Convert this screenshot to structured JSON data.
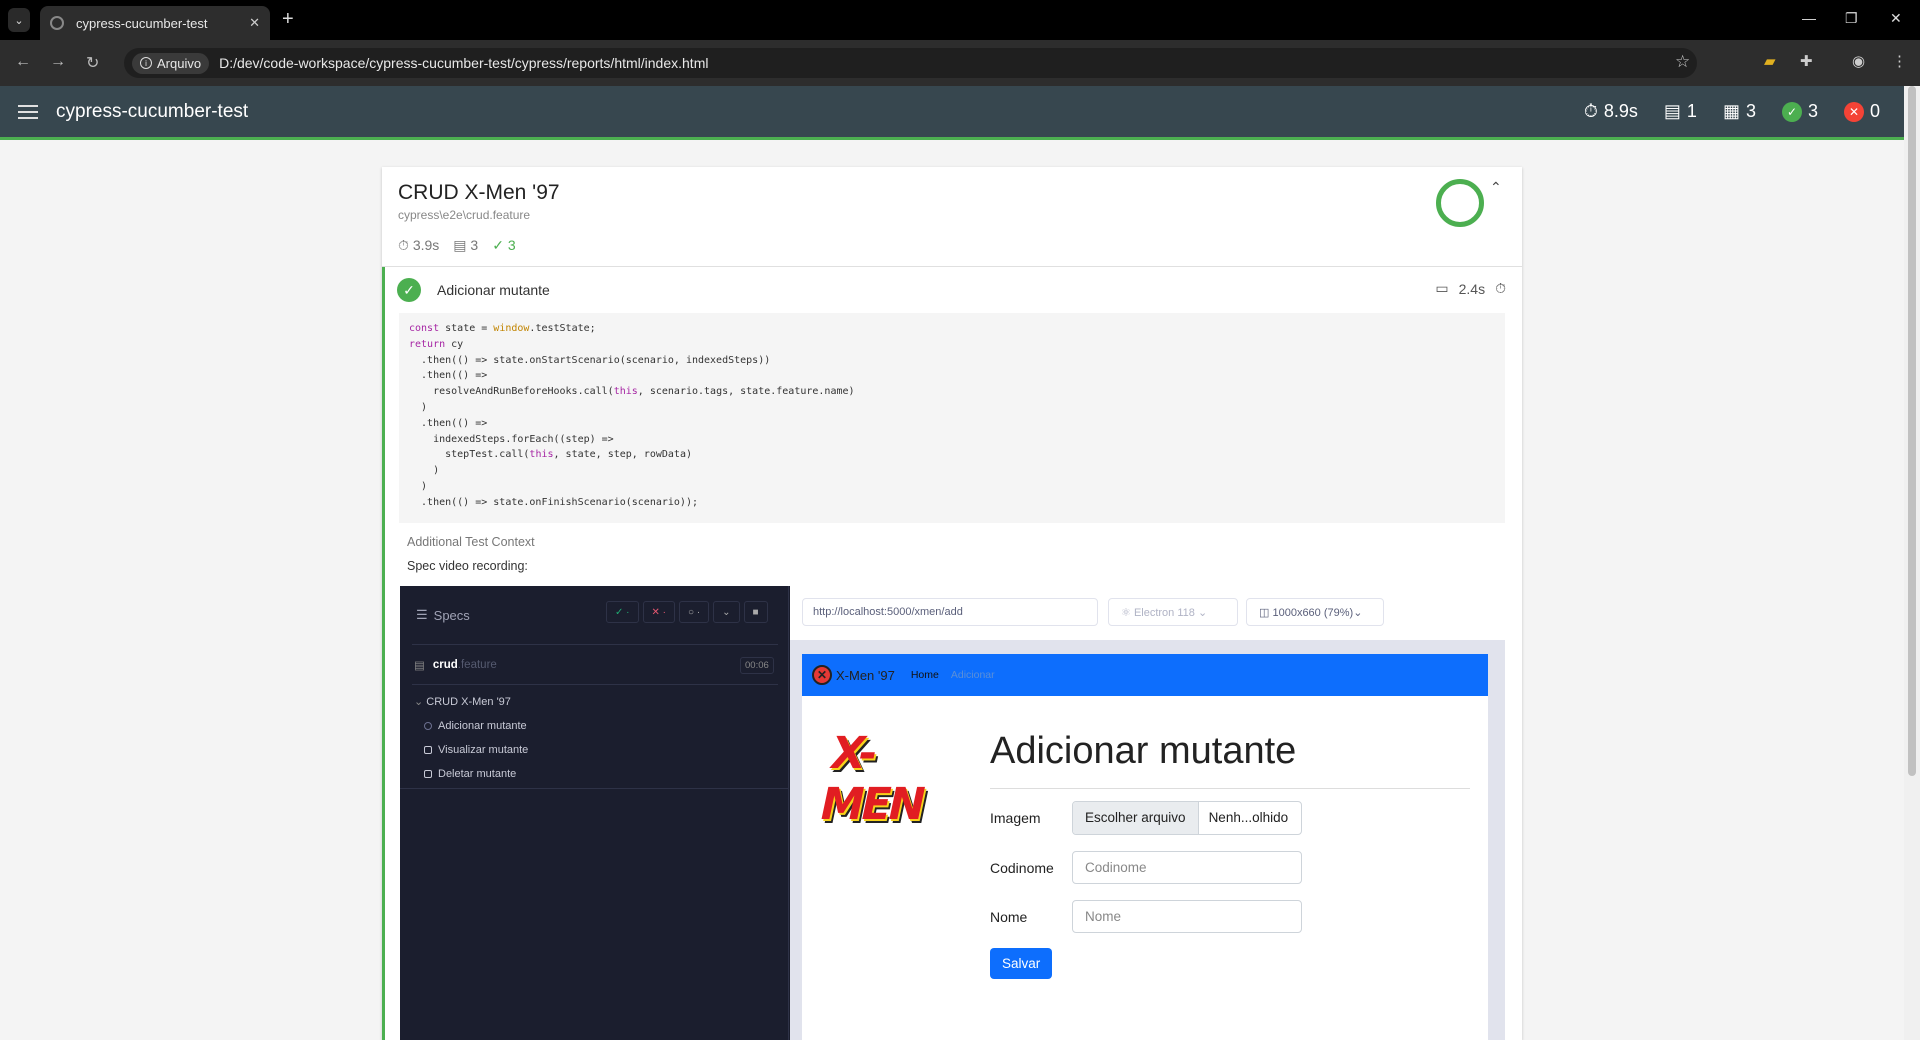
{
  "browser": {
    "tab_title": "cypress-cucumber-test",
    "chip_label": "Arquivo",
    "url": "D:/dev/code-workspace/cypress-cucumber-test/cypress/reports/html/index.html"
  },
  "header": {
    "title": "cypress-cucumber-test",
    "stats": {
      "duration": "8.9s",
      "suites": "1",
      "tests": "3",
      "passed": "3",
      "failed": "0"
    }
  },
  "suite": {
    "title": "CRUD X-Men '97",
    "file": "cypress\\e2e\\crud.feature",
    "duration": "3.9s",
    "tests": "3",
    "passed": "3"
  },
  "test": {
    "title": "Adicionar mutante",
    "duration": "2.4s",
    "context_label": "Additional Test Context",
    "context_value": "Spec video recording:"
  },
  "code_lines": [
    "return cy",
    "  .then(() => state.onStartScenario(scenario, indexedSteps))",
    "  .then(() =>",
    "    resolveAndRunBeforeHooks.call(this, scenario.tags, state.feature.name)",
    "  )",
    "  .then(() =>",
    "    indexedSteps.forEach((step) =>",
    "      stepTest.call(this, state, step, rowData)",
    "    )",
    "  )",
    "  .then(() => state.onFinishScenario(scenario));"
  ],
  "code_first": {
    "kw": "const",
    "mid": " state = ",
    "global": "window",
    "rest": ".testState;"
  },
  "cypress": {
    "specs_label": "Specs",
    "spec_file": "crud",
    "spec_ext": ".feature",
    "spec_time": "00:06",
    "suite": "CRUD X-Men '97",
    "tests": [
      "Adicionar mutante",
      "Visualizar mutante",
      "Deletar mutante"
    ],
    "url": "http://localhost:5000/xmen/add",
    "browser": "Electron 118",
    "viewport": "1000x660  (79%)"
  },
  "app": {
    "brand": "X-Men '97",
    "nav_home": "Home",
    "nav_add": "Adicionar",
    "logo_text": "X-MEN",
    "heading": "Adicionar mutante",
    "label_image": "Imagem",
    "file_button": "Escolher arquivo",
    "file_name": "Nenh...olhido",
    "label_codename": "Codinome",
    "placeholder_codename": "Codinome",
    "label_name": "Nome",
    "placeholder_name": "Nome",
    "save": "Salvar"
  }
}
